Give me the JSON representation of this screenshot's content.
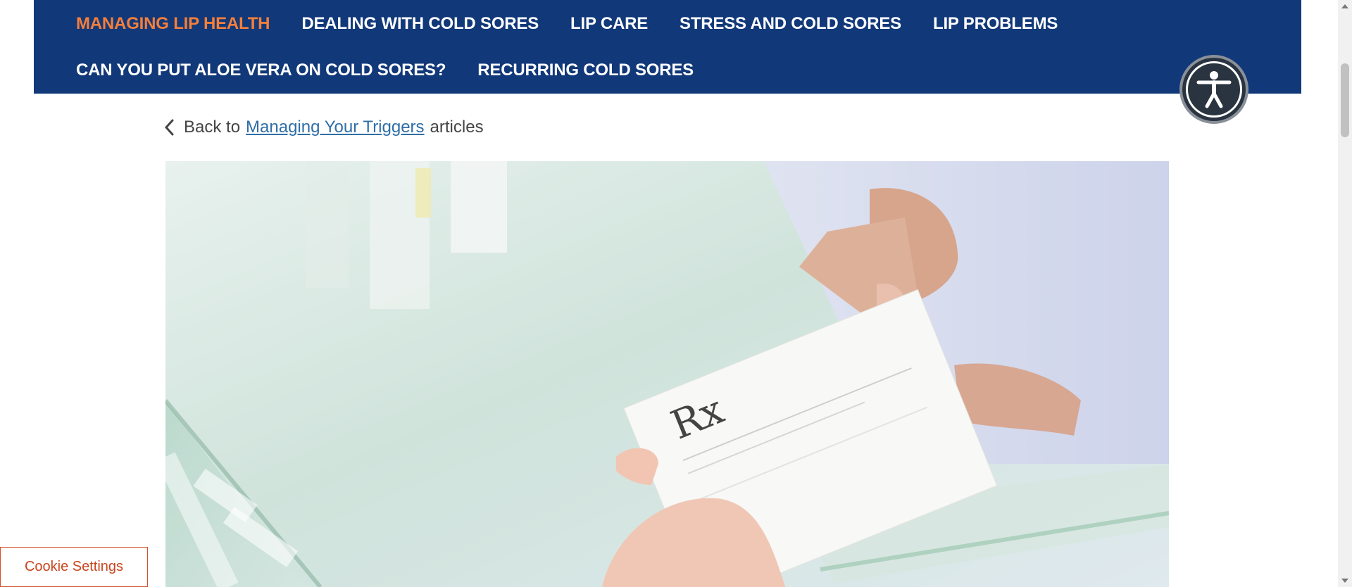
{
  "nav": {
    "items": [
      {
        "label": "MANAGING LIP HEALTH",
        "active": true
      },
      {
        "label": "DEALING WITH COLD SORES"
      },
      {
        "label": "LIP CARE"
      },
      {
        "label": "STRESS AND COLD SORES"
      },
      {
        "label": "LIP PROBLEMS"
      },
      {
        "label": "CAN YOU PUT ALOE VERA ON COLD SORES?"
      },
      {
        "label": "RECURRING COLD SORES"
      }
    ]
  },
  "colors": {
    "nav_bg": "#113879",
    "nav_active": "#f47f3b",
    "link": "#2f6ea6",
    "cookie_accent": "#c8461f"
  },
  "breadcrumb": {
    "prefix": "Back to",
    "link_text": "Managing Your Triggers",
    "suffix": "articles"
  },
  "hero": {
    "description_icon": "prescription-handover-photo",
    "rx_text": "Rx"
  },
  "accessibility": {
    "icon": "accessibility-person-icon"
  },
  "cookie": {
    "label": "Cookie Settings"
  }
}
